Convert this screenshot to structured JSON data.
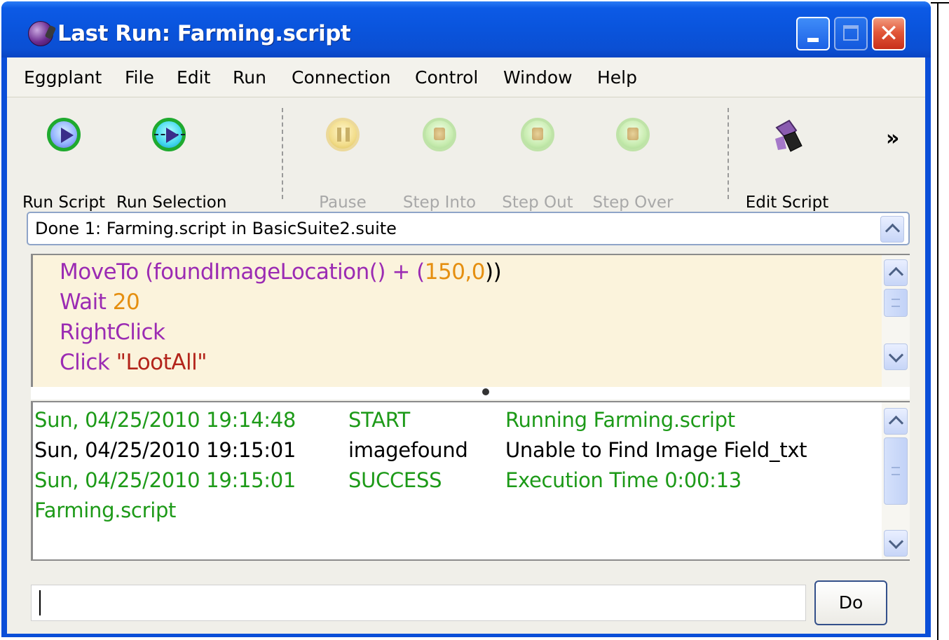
{
  "window": {
    "title": "Last Run: Farming.script"
  },
  "menubar": {
    "items": [
      "Eggplant",
      "File",
      "Edit",
      "Run",
      "Connection",
      "Control",
      "Window",
      "Help"
    ]
  },
  "toolbar": {
    "run_script": "Run Script",
    "run_selection": "Run Selection",
    "pause": "Pause",
    "step_into": "Step Into",
    "step_out": "Step Out",
    "step_over": "Step Over",
    "edit_script": "Edit Script",
    "overflow": "»"
  },
  "status": {
    "text": "Done 1: Farming.script in BasicSuite2.suite"
  },
  "script": {
    "line1": {
      "kw": "MoveTo",
      "a": " (",
      "fn": "foundImageLocation()",
      "b": " + (",
      "num": "150,0",
      "c": "))"
    },
    "line2": {
      "kw": "Wait",
      "num": " 20"
    },
    "line3": {
      "kw": "RightClick"
    },
    "line4": {
      "kw": "Click",
      "str": " \"LootAll\""
    }
  },
  "log": {
    "rows": [
      {
        "time": "Sun, 04/25/2010 19:14:48",
        "type": "START",
        "message": "Running Farming.script"
      },
      {
        "time": "Sun, 04/25/2010 19:15:01",
        "type": "imagefound",
        "message": "Unable to Find Image Field_txt"
      },
      {
        "time": "Sun, 04/25/2010 19:15:01",
        "type": "SUCCESS",
        "message": "Execution Time 0:00:13"
      }
    ],
    "trailing": "Farming.script"
  },
  "command": {
    "value": "",
    "do_label": "Do"
  },
  "colors": {
    "titlebar": "#0a54dc",
    "log_success": "#1d9a18",
    "keyword": "#9b2bb3",
    "number": "#e58f10",
    "string": "#b3241b",
    "script_bg": "#fbf3dc"
  }
}
